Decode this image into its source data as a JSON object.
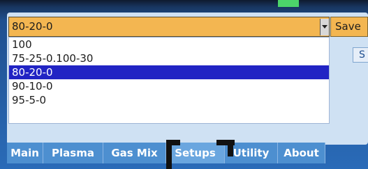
{
  "setup": {
    "selected_value": "80-20-0",
    "save_label": "Save",
    "side_label": "S"
  },
  "dropdown": {
    "options": [
      "100",
      "75-25-0.100-30",
      "80-20-0",
      "90-10-0",
      "95-5-0"
    ],
    "selected_index": 2
  },
  "tabs": [
    "Main",
    "Plasma",
    "Gas Mix",
    "Setups",
    "Utility",
    "About"
  ],
  "colors": {
    "selection": "#2124c4",
    "select_background": "#f3b651",
    "tab_background": "#4d8fd0",
    "indicator": "#4cd36a"
  }
}
